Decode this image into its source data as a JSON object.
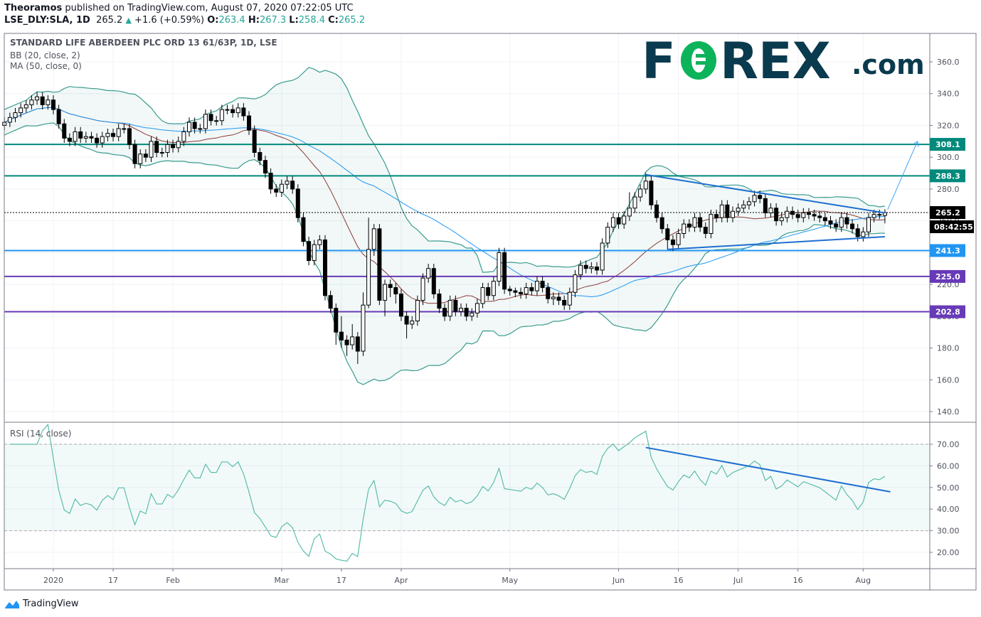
{
  "header": {
    "author": "Theoramos",
    "published": "published on TradingView.com, August 07, 2020 07:22:05 UTC",
    "symbol": "LSE_DLY:SLA, 1D",
    "last": "265.2",
    "change": "+1.6 (+0.59%)",
    "o_label": "O:",
    "o": "263.4",
    "h_label": "H:",
    "h": "267.3",
    "l_label": "L:",
    "l": "258.4",
    "c_label": "C:",
    "c": "265.2"
  },
  "logo": {
    "text": "FOREX.com"
  },
  "footer": {
    "brand": "TradingView"
  },
  "colors": {
    "up_candle": "#ffffff",
    "down_candle": "#000000",
    "bb_band": "#3a9b8f",
    "bb_basis": "#8d3b3b",
    "ma50": "#2196f3",
    "rsi": "#5cbcac",
    "trendline": "#1e6fd0"
  },
  "chart_data": [
    {
      "type": "candlestick",
      "title": "STANDARD LIFE ABERDEEN PLC ORD 13 61/63P, 1D, LSE",
      "indicators": [
        "BB (20, close, 2)",
        "MA (50, close, 0)"
      ],
      "ylim": [
        130,
        372
      ],
      "yticks": [
        360,
        340,
        320,
        300,
        280,
        260,
        240,
        220,
        200,
        180,
        160,
        140
      ],
      "ytick_labels": [
        "360.0",
        "340.0",
        "320.0",
        "300.0",
        "280.0",
        "260.0",
        "240.0",
        "220.0",
        "200.0",
        "180.0",
        "160.0",
        "140.0"
      ],
      "grid": true,
      "xticks": [
        {
          "label": "2020",
          "bar": 9
        },
        {
          "label": "17",
          "bar": 20
        },
        {
          "label": "Feb",
          "bar": 31
        },
        {
          "label": "Mar",
          "bar": 51
        },
        {
          "label": "17",
          "bar": 62
        },
        {
          "label": "Apr",
          "bar": 73
        },
        {
          "label": "May",
          "bar": 93
        },
        {
          "label": "Jun",
          "bar": 113
        },
        {
          "label": "16",
          "bar": 124
        },
        {
          "label": "Jul",
          "bar": 135
        },
        {
          "label": "16",
          "bar": 146
        },
        {
          "label": "Aug",
          "bar": 158
        }
      ],
      "open": [
        320,
        322,
        325,
        328,
        331,
        333,
        336,
        338,
        333,
        336,
        330,
        321,
        312,
        310,
        316,
        312,
        313,
        312,
        309,
        313,
        315,
        313,
        318,
        318,
        308,
        296,
        302,
        300,
        310,
        303,
        303,
        308,
        306,
        310,
        316,
        322,
        318,
        318,
        327,
        323,
        323,
        330,
        330,
        328,
        331,
        326,
        317,
        303,
        298,
        290,
        280,
        278,
        283,
        285,
        280,
        262,
        247,
        235,
        245,
        248,
        213,
        205,
        190,
        185,
        182,
        187,
        178,
        207,
        242,
        255,
        210,
        220,
        218,
        214,
        200,
        195,
        197,
        210,
        224,
        230,
        214,
        205,
        200,
        210,
        203,
        205,
        200,
        202,
        208,
        218,
        213,
        222,
        240,
        217,
        216,
        215,
        214,
        218,
        216,
        222,
        218,
        211,
        212,
        210,
        207,
        215,
        226,
        232,
        230,
        231,
        229,
        246,
        256,
        262,
        258,
        263,
        268,
        275,
        280,
        285,
        270,
        262,
        255,
        248,
        245,
        252,
        258,
        256,
        262,
        256,
        252,
        264,
        262,
        270,
        262,
        266,
        268,
        270,
        272,
        276,
        274,
        265,
        268,
        260,
        262,
        266,
        264,
        262,
        265,
        264,
        263,
        262,
        260,
        258,
        256,
        262,
        258,
        255,
        250,
        253,
        262,
        264,
        263.4
      ],
      "high": [
        325,
        328,
        331,
        334,
        336,
        339,
        341,
        341,
        339,
        339,
        333,
        324,
        315,
        319,
        319,
        316,
        316,
        315,
        316,
        318,
        318,
        321,
        321,
        321,
        311,
        305,
        305,
        313,
        313,
        306,
        311,
        311,
        313,
        319,
        325,
        325,
        321,
        330,
        330,
        326,
        333,
        333,
        333,
        334,
        334,
        329,
        320,
        306,
        301,
        293,
        283,
        286,
        288,
        288,
        283,
        265,
        250,
        248,
        251,
        251,
        216,
        208,
        200,
        188,
        195,
        190,
        215,
        262,
        258,
        258,
        223,
        223,
        221,
        217,
        203,
        200,
        213,
        227,
        233,
        233,
        217,
        208,
        213,
        213,
        208,
        208,
        205,
        211,
        221,
        221,
        225,
        243,
        243,
        219,
        218,
        218,
        221,
        221,
        225,
        225,
        221,
        215,
        215,
        213,
        218,
        229,
        235,
        235,
        234,
        234,
        249,
        259,
        265,
        265,
        266,
        278,
        278,
        283,
        290,
        288,
        273,
        265,
        258,
        251,
        255,
        261,
        261,
        265,
        265,
        259,
        267,
        267,
        273,
        273,
        269,
        271,
        273,
        275,
        279,
        279,
        277,
        271,
        271,
        265,
        269,
        269,
        267,
        268,
        268,
        267,
        266,
        265,
        263,
        261,
        265,
        265,
        261,
        258,
        256,
        265,
        267,
        267,
        267.3
      ],
      "low": [
        317,
        319,
        322,
        325,
        328,
        330,
        333,
        330,
        330,
        327,
        318,
        309,
        307,
        307,
        309,
        309,
        309,
        306,
        306,
        310,
        310,
        310,
        315,
        305,
        293,
        293,
        297,
        297,
        300,
        300,
        300,
        303,
        303,
        307,
        313,
        315,
        315,
        315,
        320,
        320,
        320,
        327,
        325,
        325,
        323,
        314,
        300,
        295,
        287,
        277,
        275,
        275,
        280,
        277,
        259,
        244,
        232,
        232,
        242,
        210,
        202,
        182,
        180,
        175,
        179,
        170,
        175,
        205,
        238,
        207,
        200,
        212,
        208,
        197,
        186,
        192,
        194,
        207,
        221,
        211,
        202,
        197,
        197,
        200,
        200,
        197,
        197,
        199,
        205,
        210,
        210,
        219,
        214,
        213,
        212,
        211,
        211,
        213,
        213,
        215,
        208,
        207,
        207,
        204,
        204,
        212,
        223,
        227,
        227,
        226,
        226,
        243,
        253,
        255,
        255,
        260,
        265,
        272,
        277,
        267,
        259,
        252,
        242,
        241,
        242,
        249,
        253,
        253,
        253,
        249,
        249,
        259,
        259,
        259,
        259,
        263,
        265,
        267,
        269,
        271,
        262,
        262,
        257,
        257,
        259,
        261,
        259,
        259,
        261,
        260,
        259,
        257,
        255,
        253,
        253,
        255,
        252,
        247,
        247,
        250,
        259,
        261,
        258.4
      ],
      "close": [
        322,
        325,
        328,
        331,
        333,
        336,
        338,
        333,
        336,
        330,
        321,
        312,
        310,
        316,
        312,
        313,
        312,
        309,
        313,
        315,
        313,
        318,
        318,
        308,
        296,
        302,
        300,
        310,
        303,
        303,
        308,
        306,
        310,
        316,
        322,
        318,
        318,
        327,
        323,
        323,
        330,
        330,
        328,
        331,
        326,
        317,
        303,
        298,
        290,
        280,
        278,
        283,
        285,
        280,
        262,
        247,
        235,
        245,
        248,
        213,
        205,
        190,
        185,
        182,
        187,
        178,
        207,
        242,
        255,
        210,
        220,
        218,
        214,
        200,
        195,
        197,
        210,
        224,
        230,
        214,
        205,
        200,
        210,
        203,
        205,
        200,
        202,
        208,
        218,
        213,
        222,
        240,
        217,
        216,
        215,
        214,
        218,
        216,
        222,
        218,
        211,
        212,
        210,
        207,
        215,
        226,
        232,
        230,
        231,
        229,
        246,
        256,
        262,
        258,
        263,
        268,
        275,
        280,
        285,
        270,
        262,
        255,
        248,
        245,
        252,
        258,
        256,
        262,
        256,
        252,
        264,
        262,
        270,
        262,
        266,
        268,
        270,
        272,
        276,
        274,
        265,
        268,
        260,
        262,
        266,
        264,
        262,
        265,
        264,
        263,
        262,
        260,
        258,
        256,
        262,
        258,
        255,
        250,
        253,
        262,
        264,
        263.6,
        265.2
      ],
      "horizontal_levels": [
        {
          "price": 308.1,
          "label": "308.1",
          "color": "#00897b"
        },
        {
          "price": 288.3,
          "label": "288.3",
          "color": "#00897b"
        },
        {
          "price": 241.3,
          "label": "241.3",
          "color": "#2196f3"
        },
        {
          "price": 225.0,
          "label": "225.0",
          "color": "#673ab7"
        },
        {
          "price": 202.8,
          "label": "202.8",
          "color": "#673ab7"
        }
      ],
      "last_price": {
        "price": 265.2,
        "label": "265.2",
        "countdown": "08:42:55"
      },
      "trendlines": [
        {
          "from": {
            "bar": 118,
            "price": 289
          },
          "to": {
            "bar": 162,
            "price": 265
          }
        },
        {
          "from": {
            "bar": 122,
            "price": 242
          },
          "to": {
            "bar": 162,
            "price": 250
          }
        }
      ],
      "projection_arrow": {
        "from": {
          "bar": 162.5,
          "price": 267
        },
        "to": {
          "bar": 168,
          "price": 310
        }
      }
    },
    {
      "type": "line",
      "title": "RSI (14, close)",
      "ylim": [
        11,
        76
      ],
      "yticks": [
        70,
        60,
        50,
        40,
        30,
        20
      ],
      "ytick_labels": [
        "70.00",
        "60.00",
        "50.00",
        "40.00",
        "30.00",
        "20.00"
      ],
      "band": [
        30,
        70
      ],
      "trendline": {
        "from": {
          "bar": 118,
          "value": 68.5
        },
        "to": {
          "bar": 163,
          "value": 48
        }
      }
    }
  ]
}
